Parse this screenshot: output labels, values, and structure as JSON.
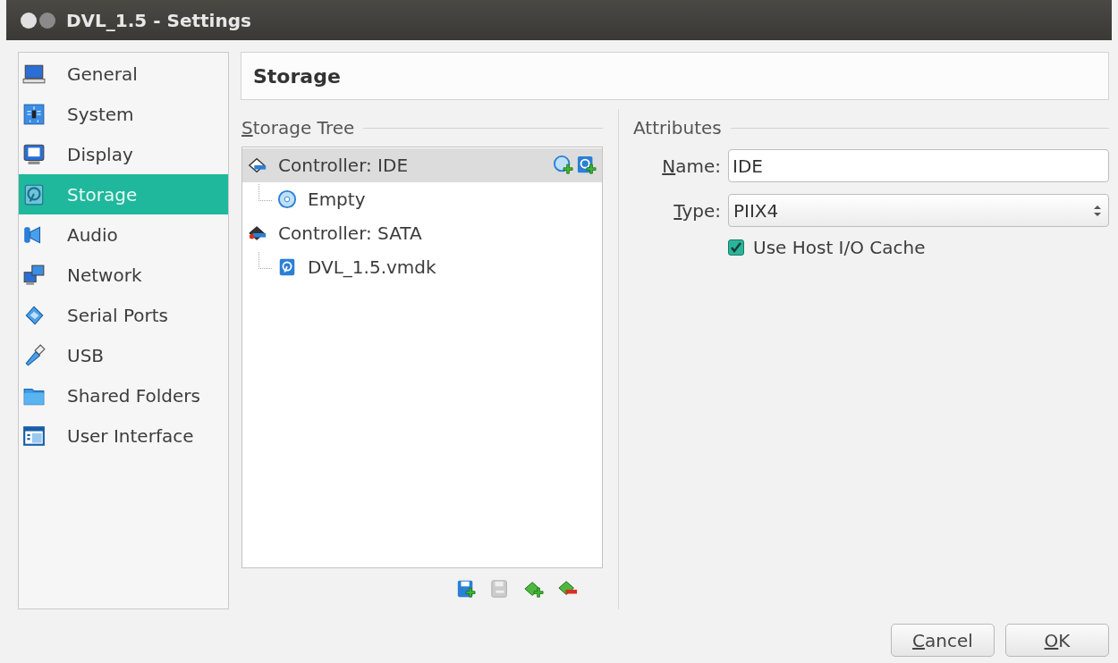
{
  "window": {
    "title": "DVL_1.5 - Settings"
  },
  "sidebar": {
    "items": [
      {
        "label": "General",
        "selected": false
      },
      {
        "label": "System",
        "selected": false
      },
      {
        "label": "Display",
        "selected": false
      },
      {
        "label": "Storage",
        "selected": true
      },
      {
        "label": "Audio",
        "selected": false
      },
      {
        "label": "Network",
        "selected": false
      },
      {
        "label": "Serial Ports",
        "selected": false
      },
      {
        "label": "USB",
        "selected": false
      },
      {
        "label": "Shared Folders",
        "selected": false
      },
      {
        "label": "User Interface",
        "selected": false
      }
    ]
  },
  "page": {
    "title": "Storage"
  },
  "storage_tree": {
    "title": "Storage Tree",
    "items": [
      {
        "kind": "ide-controller",
        "label": "Controller: IDE",
        "selected": true,
        "children": [
          {
            "kind": "optical",
            "label": "Empty",
            "selected": false
          }
        ]
      },
      {
        "kind": "sata-controller",
        "label": "Controller: SATA",
        "selected": false,
        "children": [
          {
            "kind": "disk",
            "label": "DVL_1.5.vmdk",
            "selected": false
          }
        ]
      }
    ]
  },
  "attributes": {
    "title": "Attributes",
    "name_label": "Name:",
    "name_value": "IDE",
    "type_label": "Type:",
    "type_value": "PIIX4",
    "host_cache": {
      "label": "Use Host I/O Cache",
      "checked": true
    }
  },
  "buttons": [
    "Cancel",
    "OK"
  ]
}
